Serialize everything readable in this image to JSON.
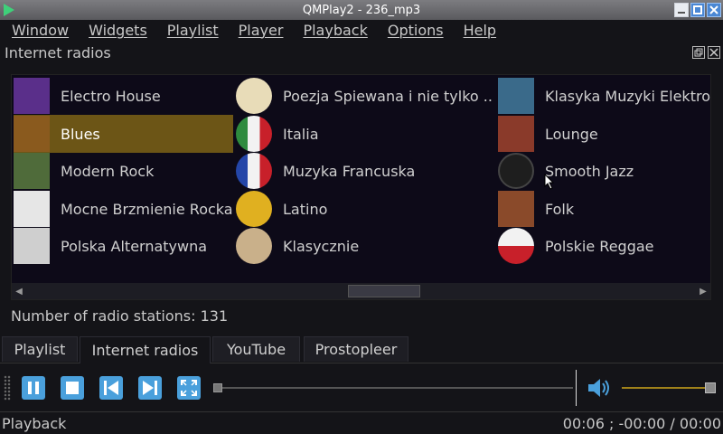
{
  "window": {
    "title": "QMPlay2 - 236_mp3"
  },
  "menu": [
    "Window",
    "Widgets",
    "Playlist",
    "Player",
    "Playback",
    "Options",
    "Help"
  ],
  "dock": {
    "title": "Internet radios"
  },
  "stations": [
    {
      "name": "Electro House",
      "icon": "electro-house-cover",
      "color": "#5a2f8a",
      "selected": false
    },
    {
      "name": "Blues",
      "icon": "blues-cover",
      "color": "#8a5a1e",
      "selected": true
    },
    {
      "name": "Modern Rock",
      "icon": "modern-rock-cover",
      "color": "#4f6b3a",
      "selected": false
    },
    {
      "name": "Mocne Brzmienie Rocka",
      "icon": "mocne-brzmienie-cover",
      "color": "#e6e6e6",
      "selected": false
    },
    {
      "name": "Polska Alternatywna",
      "icon": "polska-alternatywna-cover",
      "color": "#cfcfcf",
      "selected": false
    },
    {
      "name": "Poezja Spiewana i nie tylko ...",
      "icon": "lyre-icon",
      "color": "#e8dcb8",
      "selected": false
    },
    {
      "name": "Italia",
      "icon": "italy-flag-icon",
      "color": "#2e8b3e",
      "selected": false
    },
    {
      "name": "Muzyka Francuska",
      "icon": "france-flag-icon",
      "color": "#2446a8",
      "selected": false
    },
    {
      "name": "Latino",
      "icon": "latino-icon",
      "color": "#e0b020",
      "selected": false
    },
    {
      "name": "Klasycznie",
      "icon": "violin-icon",
      "color": "#c9b08a",
      "selected": false
    },
    {
      "name": "Klasyka Muzyki Elektronicznej",
      "icon": "klasyka-elektro-cover",
      "color": "#3a6a8a",
      "selected": false
    },
    {
      "name": "Lounge",
      "icon": "lounge-cover",
      "color": "#8a3a2a",
      "selected": false
    },
    {
      "name": "Smooth Jazz",
      "icon": "saxophone-icon",
      "color": "#2a2a2a",
      "selected": false
    },
    {
      "name": "Folk",
      "icon": "folk-cover",
      "color": "#8a4a2a",
      "selected": false
    },
    {
      "name": "Polskie Reggae",
      "icon": "reggae-icon",
      "color": "#c82020",
      "selected": false
    }
  ],
  "station_count_label": "Number of radio stations: 131",
  "tabs": [
    {
      "label": "Playlist",
      "active": false
    },
    {
      "label": "Internet radios",
      "active": true
    },
    {
      "label": "YouTube",
      "active": false
    },
    {
      "label": "Prostopleer",
      "active": false
    }
  ],
  "player": {
    "buttons": [
      "pause-icon",
      "stop-icon",
      "previous-icon",
      "next-icon",
      "fullscreen-icon"
    ],
    "accent": "#4aa0dc",
    "seek_fraction": 0.0,
    "volume_fraction": 1.0
  },
  "status": {
    "left": "Playback",
    "right": "00:06 ; -00:00 / 00:00"
  }
}
